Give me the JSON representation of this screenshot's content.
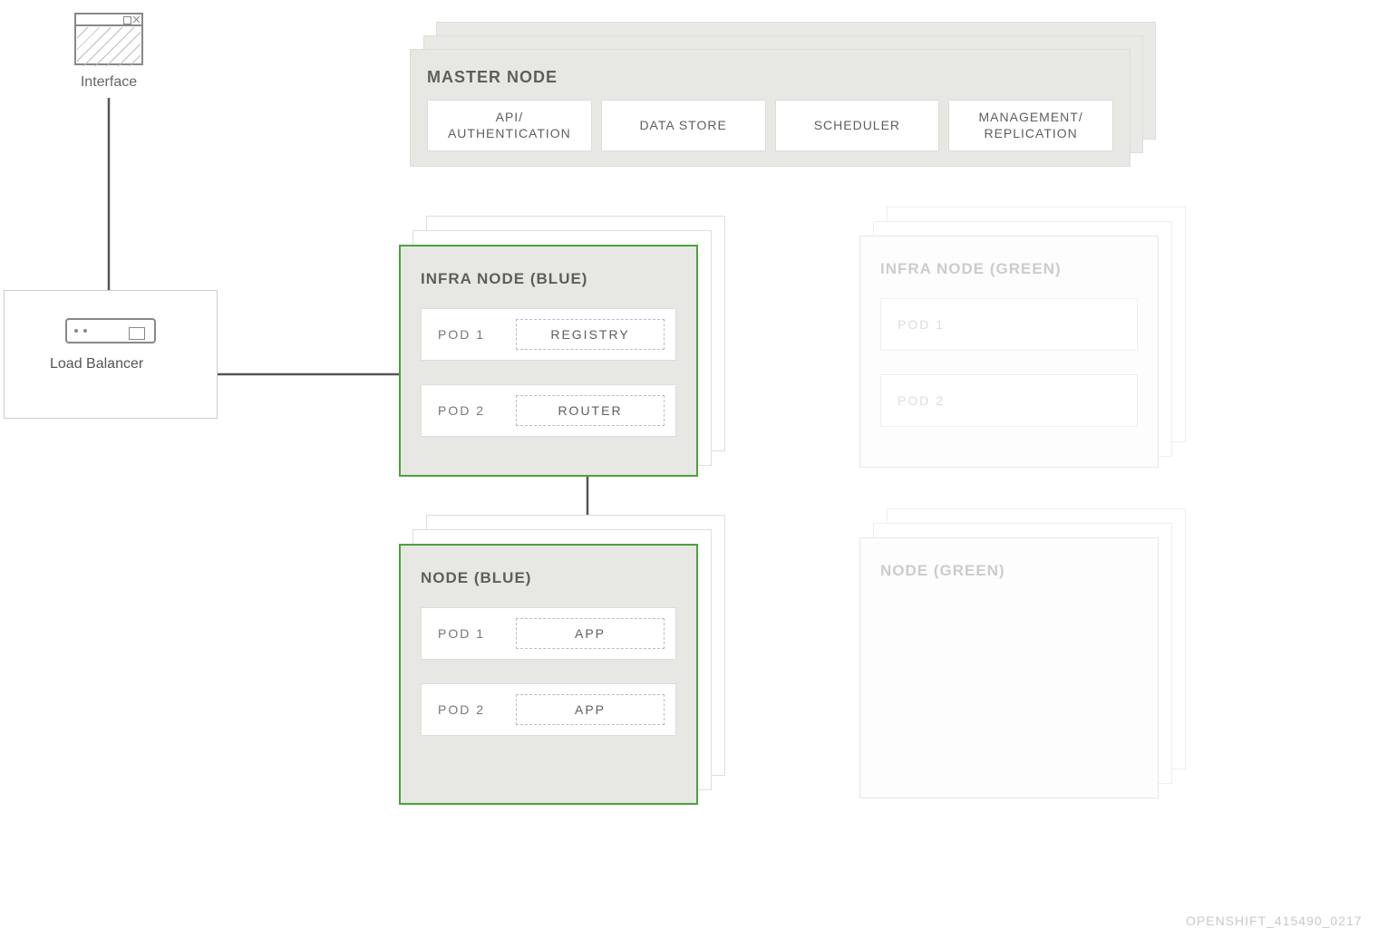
{
  "interface": {
    "label": "Interface"
  },
  "load_balancer": {
    "label": "Load Balancer"
  },
  "master": {
    "title": "MASTER NODE",
    "items": [
      "API/\nAUTHENTICATION",
      "DATA STORE",
      "SCHEDULER",
      "MANAGEMENT/\nREPLICATION"
    ]
  },
  "infra_blue": {
    "title": "INFRA NODE (BLUE)",
    "pods": [
      {
        "label": "POD 1",
        "content": "REGISTRY"
      },
      {
        "label": "POD 2",
        "content": "ROUTER"
      }
    ]
  },
  "node_blue": {
    "title": "NODE (BLUE)",
    "pods": [
      {
        "label": "POD 1",
        "content": "APP"
      },
      {
        "label": "POD 2",
        "content": "APP"
      }
    ]
  },
  "infra_green": {
    "title": "INFRA NODE (GREEN)",
    "pods": [
      {
        "label": "POD 1"
      },
      {
        "label": "POD 2"
      }
    ]
  },
  "node_green": {
    "title": "NODE (GREEN)"
  },
  "footer": {
    "id": "OPENSHIFT_415490_0217"
  },
  "colors": {
    "node_border_active": "#4aa33a",
    "panel_bg": "#e7e7e4",
    "text": "#5f5f5a",
    "faded": "#d0d0d0"
  }
}
